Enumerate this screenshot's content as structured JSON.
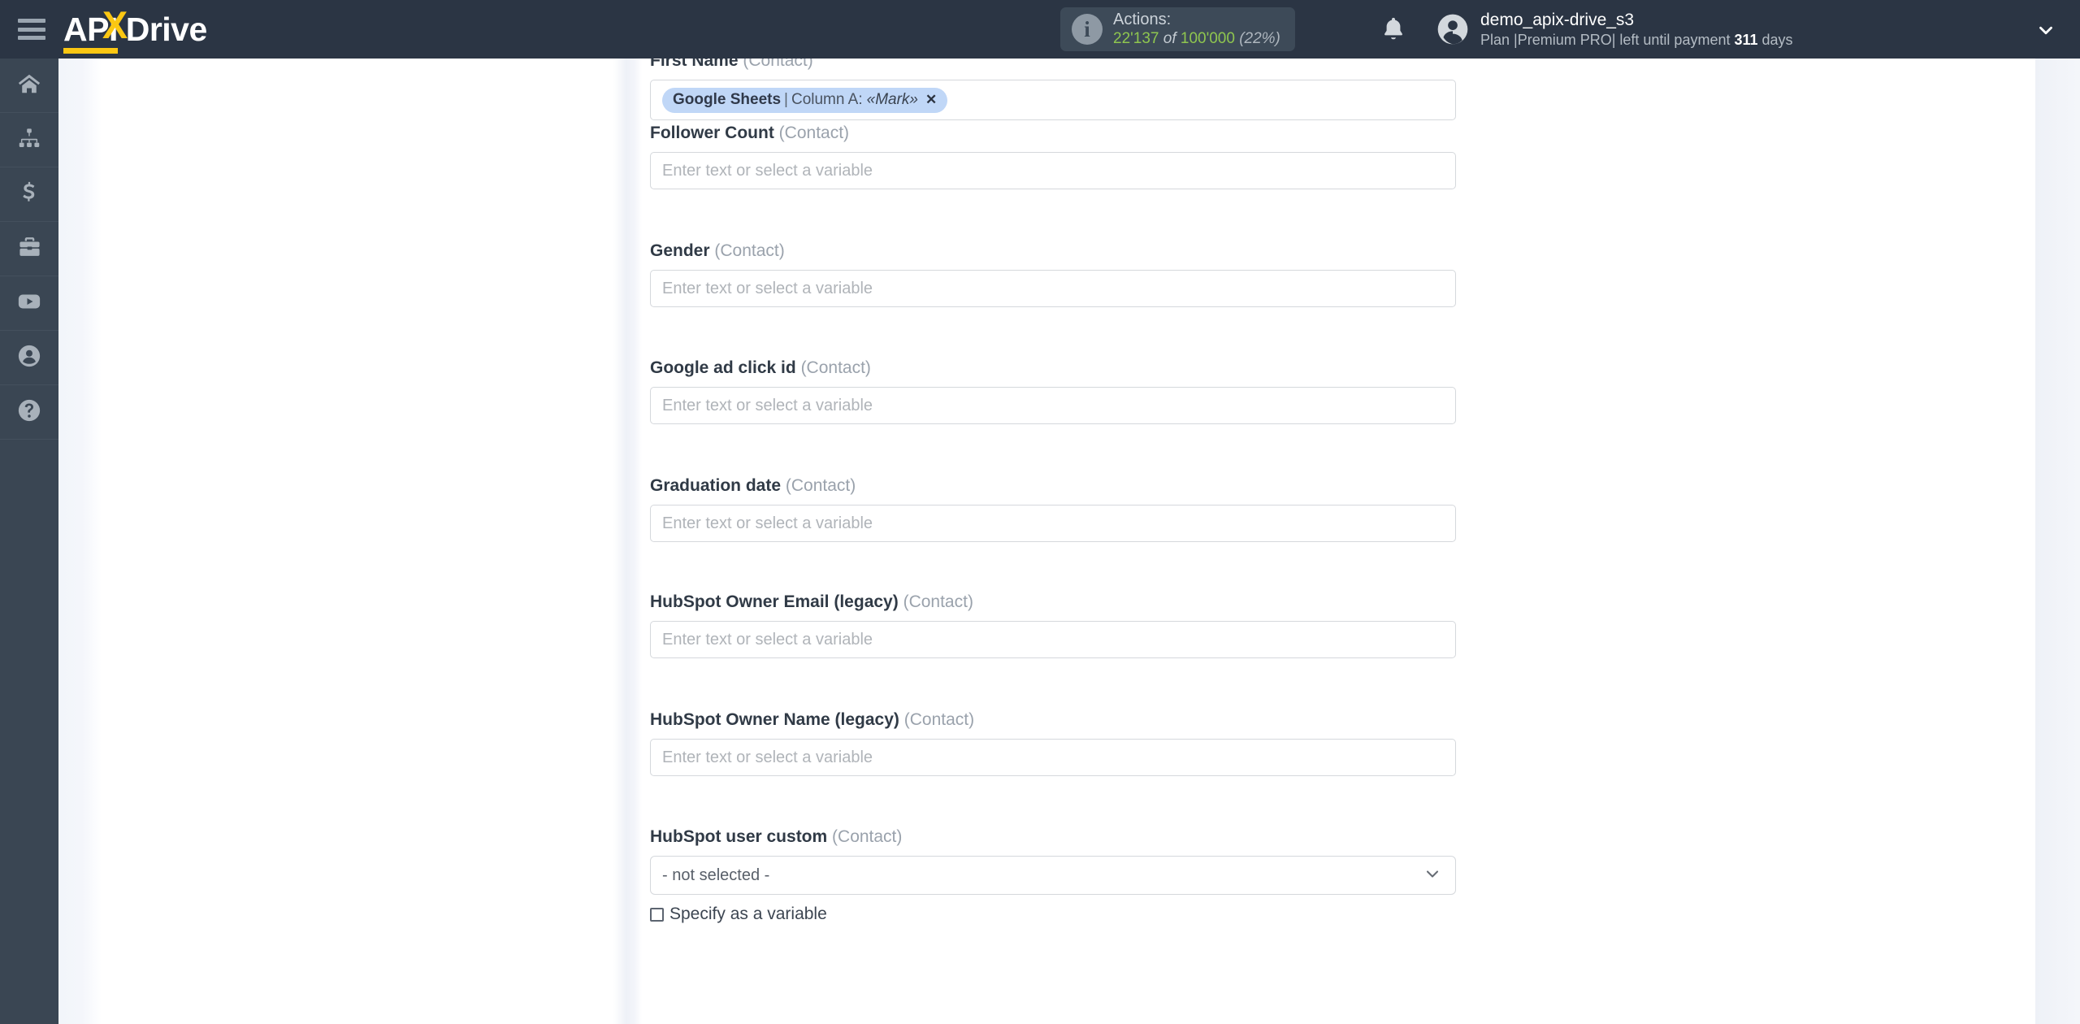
{
  "header": {
    "menu_icon": "hamburger-icon",
    "logo": {
      "part1": "API",
      "part2": "X",
      "part3": "Drive"
    },
    "actions": {
      "icon": "info-icon",
      "label": "Actions:",
      "used": "22'137",
      "of": "of",
      "total": "100'000",
      "percent": "(22%)"
    },
    "notifications_icon": "bell-icon",
    "account": {
      "avatar_icon": "user-circle-icon",
      "name": "demo_apix-drive_s3",
      "plan_prefix": "Plan |Premium PRO| left until payment ",
      "plan_days": "311",
      "plan_suffix": " days",
      "caret_icon": "chevron-down-icon"
    }
  },
  "sidebar": {
    "items": [
      {
        "name": "home",
        "icon": "home-icon"
      },
      {
        "name": "connections",
        "icon": "sitemap-icon"
      },
      {
        "name": "billing",
        "icon": "dollar-icon"
      },
      {
        "name": "business",
        "icon": "briefcase-icon"
      },
      {
        "name": "video",
        "icon": "youtube-icon"
      },
      {
        "name": "profile",
        "icon": "user-circle-icon"
      },
      {
        "name": "help",
        "icon": "question-circle-icon"
      }
    ]
  },
  "form": {
    "object_suffix": "(Contact)",
    "placeholder": "Enter text or select a variable",
    "fields": [
      {
        "label": "First Name",
        "object": "(Contact)",
        "type": "tag",
        "tag": {
          "source": "Google Sheets",
          "separator": "|",
          "column": "Column A:",
          "value": "«Mark»",
          "remove_icon": "close-icon"
        }
      },
      {
        "label": "Follower Count",
        "object": "(Contact)",
        "type": "text",
        "value": "",
        "placeholder": "Enter text or select a variable"
      },
      {
        "label": "Gender",
        "object": "(Contact)",
        "type": "text",
        "value": "",
        "placeholder": "Enter text or select a variable"
      },
      {
        "label": "Google ad click id",
        "object": "(Contact)",
        "type": "text",
        "value": "",
        "placeholder": "Enter text or select a variable"
      },
      {
        "label": "Graduation date",
        "object": "(Contact)",
        "type": "text",
        "value": "",
        "placeholder": "Enter text or select a variable"
      },
      {
        "label": "HubSpot Owner Email (legacy)",
        "object": "(Contact)",
        "type": "text",
        "value": "",
        "placeholder": "Enter text or select a variable"
      },
      {
        "label": "HubSpot Owner Name (legacy)",
        "object": "(Contact)",
        "type": "text",
        "value": "",
        "placeholder": "Enter text or select a variable"
      },
      {
        "label": "HubSpot user custom",
        "object": "(Contact)",
        "type": "select",
        "selected": "- not selected -",
        "chevron_icon": "chevron-down-icon",
        "checkbox": {
          "label": "Specify as a variable",
          "checked": false
        }
      }
    ]
  },
  "colors": {
    "header_bg": "#2b3544",
    "sidebar_bg": "#3a4653",
    "brand_yellow": "#fbc712",
    "accent_green": "#8fc64f",
    "tag_bg": "#c0d7f7",
    "border": "#d5d8dc"
  }
}
